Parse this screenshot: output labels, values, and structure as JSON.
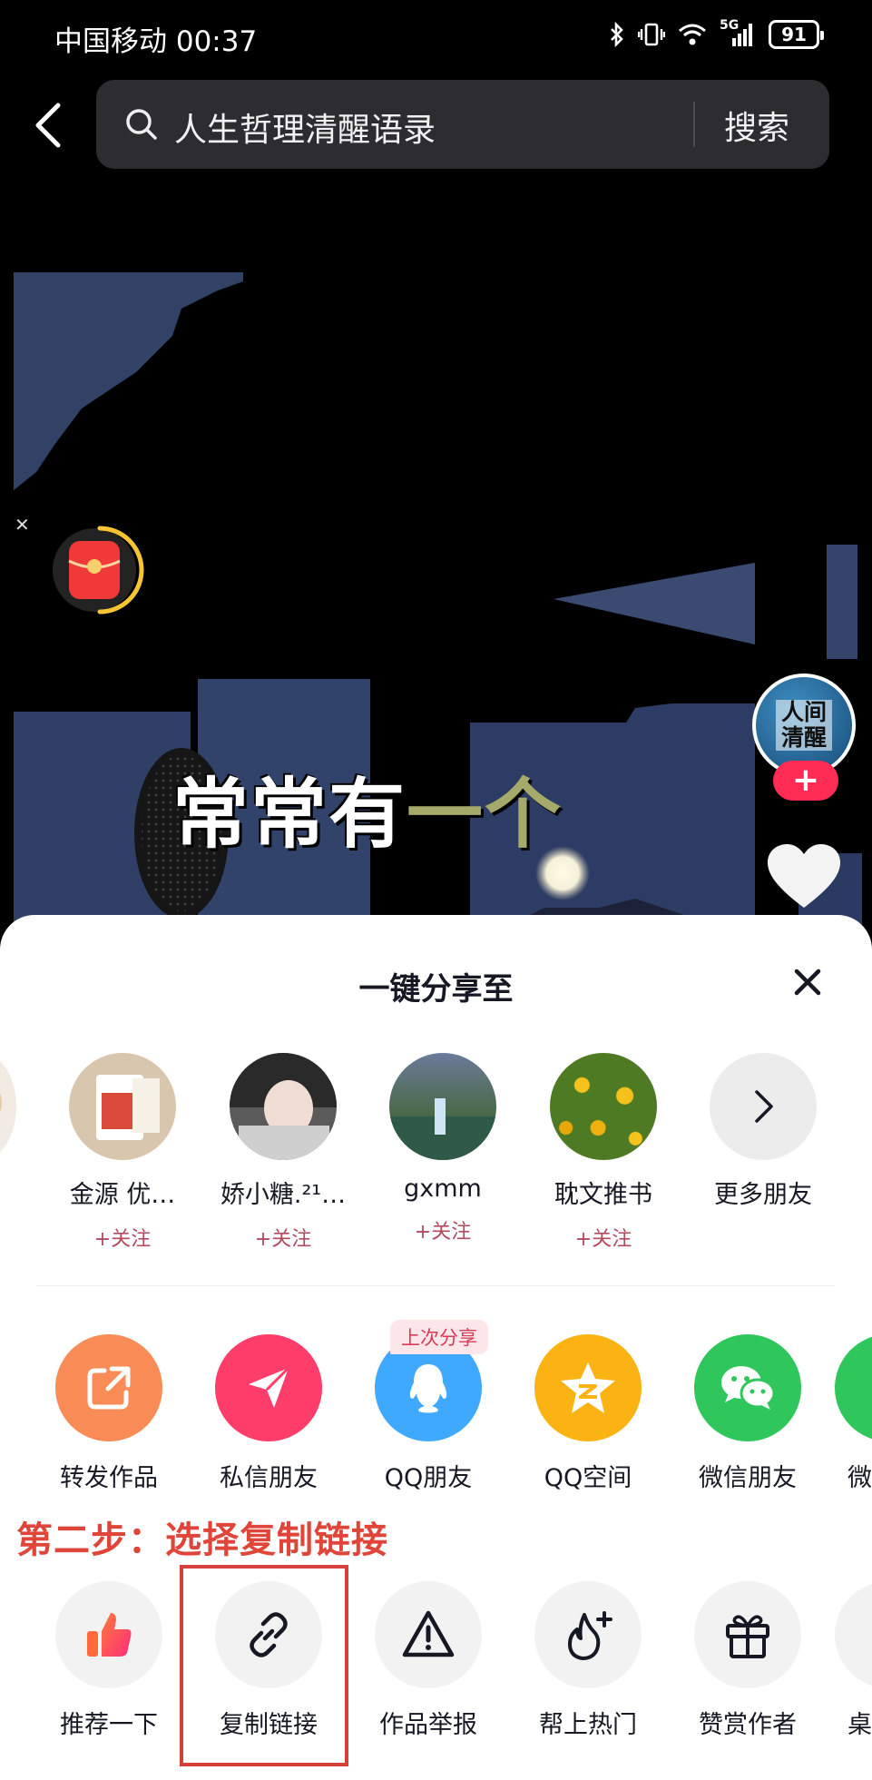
{
  "status_bar": {
    "carrier": "中国移动",
    "time": "00:37",
    "network": "5G",
    "battery": "91"
  },
  "search": {
    "query": "人生哲理清醒语录",
    "button_label": "搜索"
  },
  "video": {
    "subtitle_main": "常常有",
    "subtitle_fade": "一个",
    "creator_avatar_text": "人间清醒",
    "follow_symbol": "+"
  },
  "share_sheet": {
    "title": "一键分享至",
    "friends": [
      {
        "name": "金源  优…",
        "action": "+关注"
      },
      {
        "name": "娇小糖.²¹…",
        "action": "+关注"
      },
      {
        "name": "gxmm",
        "action": "+关注"
      },
      {
        "name": "耽文推书",
        "action": "+关注"
      }
    ],
    "more_friends_label": "更多朋友",
    "last_share_badge": "上次分享",
    "share_apps": [
      {
        "label": "转发作品",
        "color": "#f98b56",
        "icon": "repost-icon"
      },
      {
        "label": "私信朋友",
        "color": "#fe3d6a",
        "icon": "send-icon"
      },
      {
        "label": "QQ朋友",
        "color": "#3fa9ff",
        "icon": "qq-icon"
      },
      {
        "label": "QQ空间",
        "color": "#fbb313",
        "icon": "qzone-icon"
      },
      {
        "label": "微信朋友",
        "color": "#2fc65c",
        "icon": "wechat-icon"
      }
    ],
    "partial_app_label": "微",
    "step_instruction": "第二步：选择复制链接",
    "actions": [
      {
        "label": "推荐一下",
        "icon": "thumbs-up-icon"
      },
      {
        "label": "复制链接",
        "icon": "link-icon"
      },
      {
        "label": "作品举报",
        "icon": "warning-icon"
      },
      {
        "label": "帮上热门",
        "icon": "flame-plus-icon"
      },
      {
        "label": "赞赏作者",
        "icon": "gift-icon"
      }
    ],
    "partial_action_label": "桌"
  }
}
